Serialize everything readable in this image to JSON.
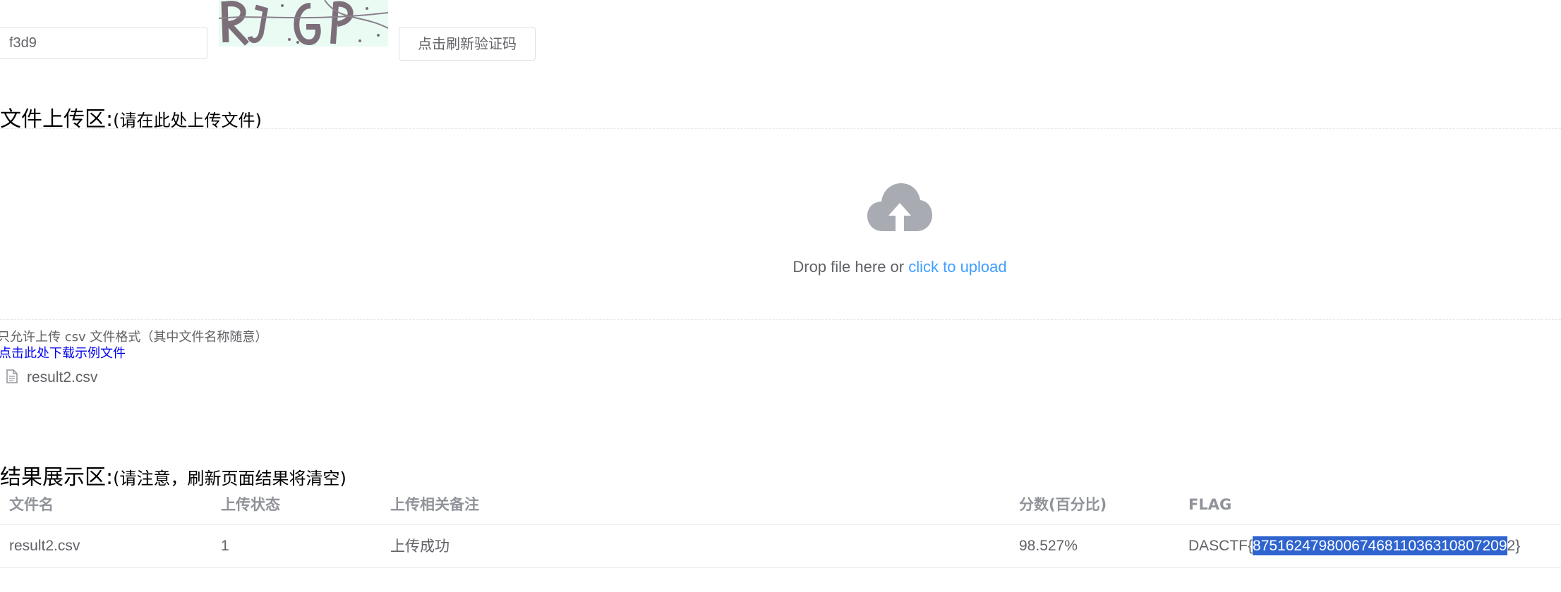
{
  "captcha": {
    "input_value": "f3d9",
    "refresh_label": "点击刷新验证码"
  },
  "upload": {
    "title": "文件上传区:",
    "subtitle": "(请在此处上传文件)",
    "drop_text": "Drop file here or ",
    "drop_link": "click to upload",
    "tip": "只允许上传 csv 文件格式（其中文件名称随意）",
    "download_link": "点击此处下载示例文件",
    "file_name": "result2.csv",
    "icon": "cloud-upload-icon"
  },
  "results": {
    "title": "结果展示区:",
    "subtitle": "(请注意，刷新页面结果将清空)",
    "columns": [
      "文件名",
      "上传状态",
      "上传相关备注",
      "分数(百分比)",
      "FLAG"
    ],
    "rows": [
      {
        "file_name": "result2.csv",
        "status": "1",
        "note": "上传成功",
        "score": "98.527%",
        "flag_prefix": "DASCTF{",
        "flag_selected": "8751624798006746811036310807209",
        "flag_suffix": "2}"
      }
    ]
  },
  "colors": {
    "accent": "#409eff",
    "selection": "#2f64cf",
    "link": "#0000ee"
  }
}
